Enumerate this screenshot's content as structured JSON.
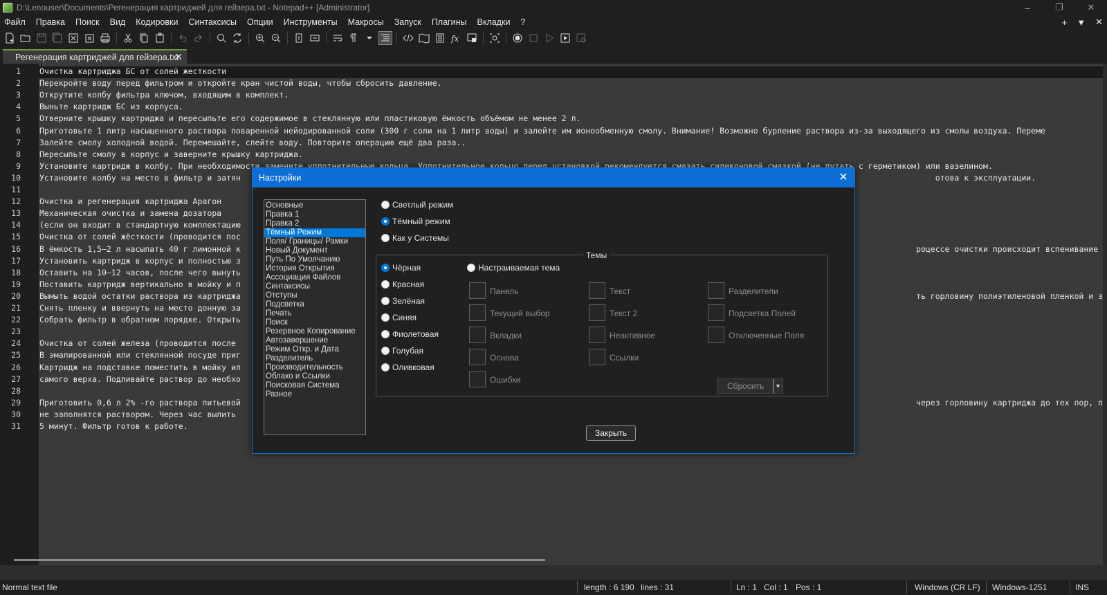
{
  "window": {
    "title": "D:\\Lenouser\\Documents\\Регенерация картриджей для гейзера.txt - Notepad++ [Administrator]",
    "controls": [
      "–",
      "❐",
      "✕"
    ]
  },
  "menu": {
    "items": [
      "Файл",
      "Правка",
      "Поиск",
      "Вид",
      "Кодировки",
      "Синтаксисы",
      "Опции",
      "Инструменты",
      "Макросы",
      "Запуск",
      "Плагины",
      "Вкладки",
      "?"
    ],
    "right": [
      "+",
      "▼",
      "✕"
    ]
  },
  "tab": {
    "label": "Регенерация картриджей для гейзера.txt",
    "close": "✕"
  },
  "editor": {
    "lines": [
      "Очистка картриджа БС от солей жесткости",
      "Перекройте воду перед фильтром и откройте кран чистой воды, чтобы сбросить давление.",
      "Открутите колбу фильтра ключом, входящим в комплект.",
      "Выньте картридж БС из корпуса.",
      "Отверните крышку картриджа и пересыпьте его содержимое в стеклянную или пластиковую ёмкость объёмом не менее 2 л.",
      "Приготовьте 1 литр насыщенного раствора поваренной нейодированной соли (300 г соли на 1 литр воды) и залейте им ионообменную смолу. Внимание! Возможно бурление раствора из-за выходящего из смолы воздуха. Переме",
      "Залейте смолу холодной водой. Перемешайте, слейте воду. Повторите операцию ещё два раза..",
      "Пересыпьте смолу в корпус и заверните крышку картриджа.",
      "Установите картридж в колбу. При необходимости замените уплотнительные кольца. Уплотнительное кольцо перед установкой рекомендуется смазать силиконовой смазкой (не путать с герметиком) или вазелином.",
      "Установите колбу на место в фильтр и затян                                                                                                                                                 отова к эксплуатации.",
      "",
      "Очистка и регенерация картриджа Арагон",
      "Механическая очистка и замена дозатора",
      "(если он входит в стандартную комплектацию",
      "Очистка от солей жёсткости (проводится пос",
      "В ёмкость 1,5–2 л насыпать 40 г лимонной к                                                                                                                                             роцессе очистки происходит вспенивание (выделение",
      "Установить картридж в корпус и полностью з",
      "Оставить на 10–12 часов, после чего вынуть",
      "Поставить картридж вертикально в мойку и п",
      "Вымыть водой остатки раствора из картриджа                                                                                                                                             ть горловину полиэтиленовой пленкой и закрепить е",
      "Снять пленку и ввернуть на место донную за",
      "Собрать фильтр в обратном порядке. Открыть",
      "",
      "Очистка от солей железа (проводится после",
      "В эмалированной или стеклянной посуде приг",
      "Картридж на подставке поместить в мойку ил",
      "самого верха. Подливайте раствор до необхо",
      "",
      "Приготовить 0,6 л 2% -го раствора питьевой                                                                                                                                             через горловину картриджа до тех пор, пока он са",
      "не заполнятся раствором. Через час вылить",
      "5 минут. Фильтр готов к работе."
    ]
  },
  "statusbar": {
    "file_type": "Normal text file",
    "length": "length : 6 190",
    "lines": "lines : 31",
    "ln": "Ln : 1",
    "col": "Col : 1",
    "pos": "Pos : 1",
    "eol": "Windows (CR LF)",
    "encoding": "Windows-1251",
    "mode": "INS"
  },
  "dialog": {
    "title": "Настройки",
    "close": "✕",
    "categories": [
      "Основные",
      "Правка 1",
      "Правка 2",
      "Тёмный Режим",
      "Поля/ Границы/ Рамки",
      "Новый Документ",
      "Путь По Умолчанию",
      "История Открытия",
      "Ассоциация Файлов",
      "Синтаксисы",
      "Отступы",
      "Подсветка",
      "Печать",
      "Поиск",
      "Резервное Копирование",
      "Автозавершение",
      "Режим Откр. и Дата",
      "Разделитель",
      "Производительность",
      "Облако и Ссылки",
      "Поисковая Система",
      "Разное"
    ],
    "selected_category": "Тёмный Режим",
    "modes": [
      {
        "label": "Светлый режим",
        "checked": false
      },
      {
        "label": "Тёмный режим",
        "checked": true
      },
      {
        "label": "Как у Системы",
        "checked": false
      }
    ],
    "themes_legend": "Темы",
    "themes": [
      {
        "label": "Чёрная",
        "checked": true
      },
      {
        "label": "Красная",
        "checked": false
      },
      {
        "label": "Зелёная",
        "checked": false
      },
      {
        "label": "Синяя",
        "checked": false
      },
      {
        "label": "Фиолетовая",
        "checked": false
      },
      {
        "label": "Голубая",
        "checked": false
      },
      {
        "label": "Оливковая",
        "checked": false
      }
    ],
    "custom_theme": {
      "label": "Настраиваемая тема",
      "checked": false
    },
    "color_slots": {
      "col1": [
        "Панель",
        "Текущий выбор",
        "Вкладки",
        "Основа",
        "Ошибки"
      ],
      "col2": [
        "Текст",
        "Текст 2",
        "Неактивное",
        "Ссылки"
      ],
      "col3": [
        "Разделители",
        "Подсветка Полей",
        "Отключенные Поля"
      ]
    },
    "reset_label": "Сбросить",
    "close_label": "Закрыть"
  },
  "colors": {
    "accent": "#0d6fd6",
    "selection": "#0078d7",
    "editor_bg": "#3a3a3a",
    "chrome_bg": "#1f1f1f",
    "tab_indicator": "#6a9e3a"
  }
}
